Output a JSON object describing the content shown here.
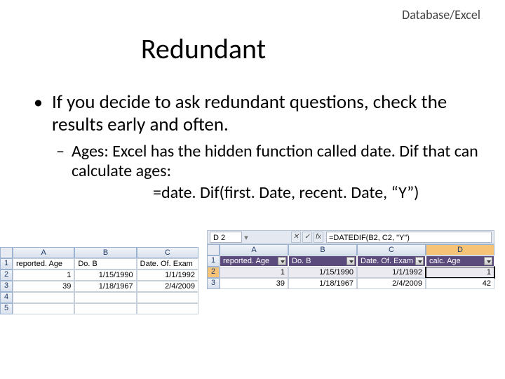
{
  "header": {
    "context": "Database/Excel"
  },
  "title": "Redundant",
  "bullet": "If you decide to ask redundant questions, check the results early and often.",
  "subBullet": "Ages: Excel has the hidden function called date. Dif that can calculate ages:",
  "formula": "=date. Dif(first. Date, recent. Date, “Y”)",
  "leftSheet": {
    "cols": [
      "A",
      "B",
      "C"
    ],
    "rows": [
      {
        "n": "1",
        "cells": [
          "reported. Age",
          "Do. B",
          "Date. Of. Exam"
        ]
      },
      {
        "n": "2",
        "cells": [
          "1",
          "1/15/1990",
          "1/1/1992"
        ]
      },
      {
        "n": "3",
        "cells": [
          "39",
          "1/18/1967",
          "2/4/2009"
        ]
      },
      {
        "n": "4",
        "cells": [
          "",
          "",
          ""
        ]
      },
      {
        "n": "5",
        "cells": [
          "",
          "",
          ""
        ]
      }
    ]
  },
  "rightSheet": {
    "nameBox": "D 2",
    "fx": "=DATEDIF(B2, C2, \"Y\")",
    "cols": [
      "A",
      "B",
      "C",
      "D"
    ],
    "headerRow": [
      "reported. Age",
      "Do. B",
      "Date. Of. Exam",
      "calc. Age"
    ],
    "rows": [
      {
        "n": "2",
        "cells": [
          "1",
          "1/15/1990",
          "1/1/1992",
          "1"
        ]
      },
      {
        "n": "3",
        "cells": [
          "39",
          "1/18/1967",
          "2/4/2009",
          "42"
        ]
      }
    ]
  }
}
